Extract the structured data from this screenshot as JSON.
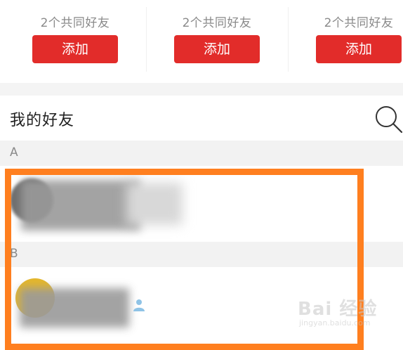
{
  "suggestions": [
    {
      "mutual": "2个共同好友",
      "button": "添加"
    },
    {
      "mutual": "2个共同好友",
      "button": "添加"
    },
    {
      "mutual": "2个共同好友",
      "button": "添加"
    }
  ],
  "friends": {
    "title": "我的好友",
    "search_icon": "search-icon"
  },
  "sections": [
    {
      "letter": "A"
    },
    {
      "letter": "B"
    }
  ],
  "colors": {
    "accent": "#e22c2a",
    "highlight": "#ff7f1f",
    "section_bg": "#f2f2f2"
  },
  "watermark": {
    "main": "Bai 经验",
    "sub": "jingyan.baidu.com"
  }
}
